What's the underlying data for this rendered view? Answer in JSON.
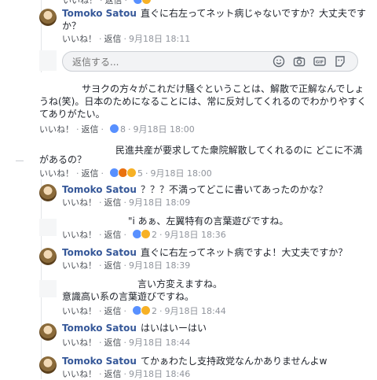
{
  "comments": [
    {
      "name": "Tomoko Satou",
      "line1": "直ぐに右左ってネット病じゃないですか？大丈夫です",
      "line2": "か？",
      "like": "いいね！",
      "reply": "返信",
      "count": "",
      "time": "9月18日 18:11"
    },
    {
      "text1": "サヨクの方々がこれだけ騒ぐということは、解散で正解なんでしょ",
      "text2": "うね(笑)。日本のためになることには、常に反対してくれるのでわかりやすく",
      "text3": "てありがたい。",
      "like": "いいね！",
      "reply": "返信",
      "count": "8",
      "time": "9月18日 18:00"
    },
    {
      "text1": "民進共産が要求してた衆院解散してくれるのに どこに不満",
      "text2": "があるの？",
      "like": "いいね！",
      "reply": "返信",
      "count": "5",
      "time": "9月18日 18:00"
    },
    {
      "name": "Tomoko Satou",
      "text": "？？？不満ってどこに書いてあったのかな？",
      "like": "いいね！",
      "reply": "返信",
      "count": "",
      "time": "9月18日 18:09"
    },
    {
      "text": "\"i あぁ、左翼特有の言葉遊びですね。",
      "like": "いいね！",
      "reply": "返信",
      "count": "2",
      "time": "9月18日 18:36"
    },
    {
      "name": "Tomoko Satou",
      "text": "直ぐに右左ってネット病ですよ！大丈夫ですか？",
      "like": "いいね！",
      "reply": "返信",
      "count": "",
      "time": "9月18日 18:39"
    },
    {
      "text1": "言い方変えますね。",
      "text2": "意識高い系の言葉遊びですね。",
      "like": "いいね！",
      "reply": "返信",
      "count": "2",
      "time": "9月18日 18:44"
    },
    {
      "name": "Tomoko Satou",
      "text": "はいはいーはい",
      "like": "いいね！",
      "reply": "返信",
      "count": "",
      "time": "9月18日 18:44"
    },
    {
      "name": "Tomoko Satou",
      "text": "てかぁわたし支持政党なんかありませんよw",
      "like": "いいね！",
      "reply": "返信",
      "count": "",
      "time": "9月18日 18:46"
    }
  ],
  "reply_box": {
    "placeholder": "返信する..."
  },
  "colors": {
    "link": "#365899",
    "meta": "#90949c",
    "like_blue": "#5890ff"
  }
}
